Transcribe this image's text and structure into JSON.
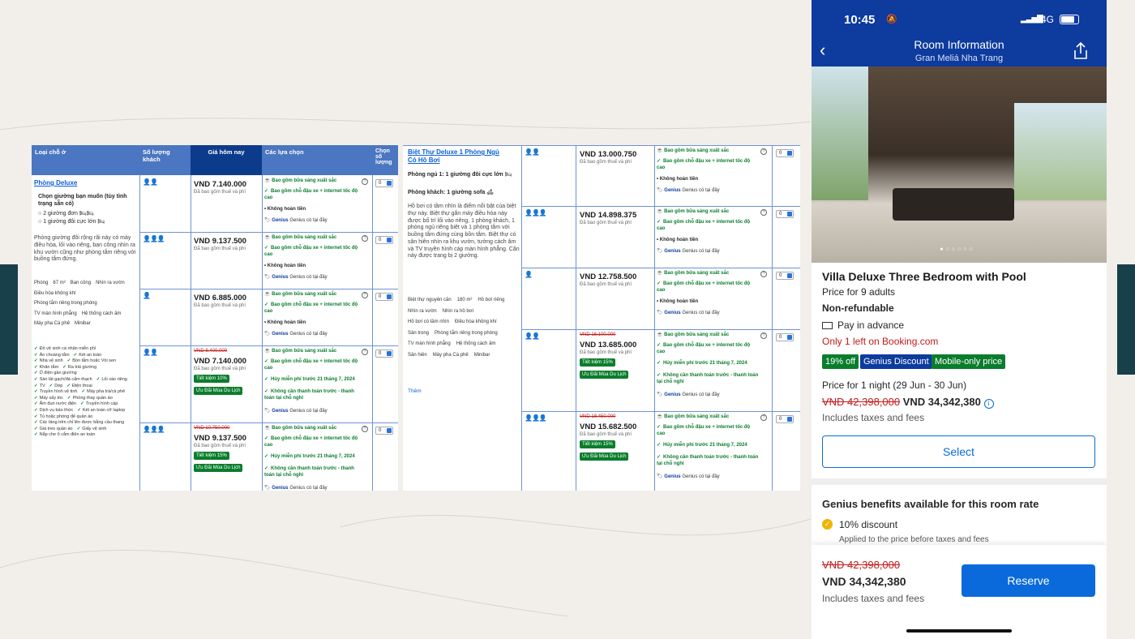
{
  "table": {
    "headers": {
      "type": "Loại chỗ ở",
      "guests": "Số lượng khách",
      "price_today": "Giá hôm nay",
      "choices": "Các lựa chọn",
      "select": "Chọn số lượng"
    },
    "room1": {
      "name": "Phòng Deluxe",
      "bed_prompt": "Chọn giường bạn muốn (tùy tình trạng sẵn có)",
      "bed_option1": "2 giường đơn",
      "bed_option2": "1 giường đôi cực lớn",
      "description": "Phòng giường đôi rộng rãi này có máy điều hòa, lối vào riêng, ban công nhìn ra khu vườn cũng như phòng tắm riêng với buồng tắm đứng.",
      "facilities": [
        "Phòng",
        "67 m²",
        "Ban công",
        "Nhìn ra vườn",
        "Điều hòa không khí",
        "Phòng tắm riêng trong phòng",
        "TV màn hình phẳng",
        "Hệ thống cách âm",
        "Máy pha Cà phê",
        "Minibar"
      ],
      "amenities": [
        "Đồ vệ sinh cá nhân miễn phí",
        "Áo choàng tắm",
        "Két an toàn",
        "Nhà vệ sinh",
        "Bồn tắm hoặc Vòi sen",
        "Khăn tắm",
        "Ra trải giường",
        "Ổ điện gần giường",
        "Sàn lát gạch/đá cẩm thạch",
        "Lối vào riêng",
        "TV",
        "Dép",
        "Điện thoại",
        "Truyền hình vệ tinh",
        "Máy pha trà/cà phê",
        "Máy sấy tóc",
        "Phòng thay quần áo",
        "Ấm đun nước điện",
        "Truyền hình cáp",
        "Dịch vụ báo thức",
        "Két an toàn cỡ laptop",
        "Tủ hoặc phòng để quần áo",
        "Các tầng trên chỉ lên được bằng cầu thang",
        "Giá treo quần áo",
        "Giấy vệ sinh",
        "Nắp che ổ cắm điện an toàn"
      ]
    },
    "room2": {
      "name": "Biệt Thự Deluxe 1 Phòng Ngủ Có Hồ Bơi",
      "bedroom": "Phòng ngủ 1: 1 giường đôi cực lớn",
      "living": "Phòng khách: 1 giường sofa",
      "description": "Hồ bơi có tầm nhìn là điểm nổi bật của biệt thự này. Biệt thự gắn máy điều hòa này được bố trí lối vào riêng, 1 phòng khách, 1 phòng ngủ riêng biệt và 1 phòng tắm với buồng tắm đứng cùng bồn tắm. Biệt thự có sân hiên nhìn ra khu vườn, tường cách âm và TV truyền hình cáp màn hình phẳng. Căn này được trang bị 2 giường.",
      "facilities": [
        "Biệt thự nguyên căn",
        "180 m²",
        "Hồ bơi riêng",
        "Nhìn ra vườn",
        "Nhìn ra hồ bơi",
        "Hồ bơi có tầm nhìn",
        "Điều hòa không khí",
        "Sân trong",
        "Phòng tắm riêng trong phòng",
        "TV màn hình phẳng",
        "Hệ thống cách âm",
        "Sân hiên",
        "Máy pha Cà phê",
        "Minibar"
      ],
      "more": "Thêm"
    },
    "taxes_note": "Đã bao gồm thuế và phí",
    "opt_breakfast": "Bao gồm bữa sáng xuất sắc",
    "opt_parking": "Bao gồm chỗ đậu xe + internet tốc độ cao",
    "opt_nonrefund": "Không hoàn tiền",
    "opt_genius": "Genius có tại đây",
    "opt_freecancel": "Hủy miễn phí trước 21 tháng 7, 2024",
    "opt_nopay": "Không cần thanh toán trước - thanh toán tại chỗ nghỉ",
    "badge_save": "Tiết kiệm 15%",
    "badge_save10": "Tiết kiệm 10%",
    "badge_deal": "Ưu Đãi Mùa Du Lịch",
    "qty": "0",
    "rows1": [
      {
        "old": "",
        "price": "VND 7.140.000"
      },
      {
        "old": "",
        "price": "VND 9.137.500"
      },
      {
        "old": "",
        "price": "VND 6.885.000"
      },
      {
        "old": "VND 8.400.000",
        "price": "VND 7.140.000"
      },
      {
        "old": "VND 10.750.000",
        "price": "VND 9.137.500"
      }
    ],
    "rows2": [
      {
        "old": "",
        "price": "VND 13.000.750"
      },
      {
        "old": "",
        "price": "VND 14.898.375"
      },
      {
        "old": "",
        "price": "VND 12.758.500"
      },
      {
        "old": "VND 16.100.000",
        "price": "VND 13.685.000"
      },
      {
        "old": "VND 18.450.000",
        "price": "VND 15.682.500"
      }
    ]
  },
  "phone": {
    "time": "10:45",
    "network": "4G",
    "header_title": "Room Information",
    "header_subtitle": "Gran Meliá Nha Trang",
    "room_title": "Villa Deluxe Three Bedroom with Pool",
    "price_for": "Price for 9 adults",
    "refund": "Non-refundable",
    "pay": "Pay in advance",
    "scarcity": "Only 1 left on Booking.com",
    "tags": [
      "19% off",
      "Genius Discount",
      "Mobile-only price"
    ],
    "price_night": "Price for 1 night (29 Jun - 30 Jun)",
    "old_price": "VND 42,398,000",
    "new_price": "VND 34,342,380",
    "includes": "Includes taxes and fees",
    "select": "Select",
    "genius_title": "Genius benefits available for this room rate",
    "discount": "10% discount",
    "discount_note": "Applied to the price before taxes and fees",
    "reserve": "Reserve",
    "colors": {
      "brand": "#0d3b9e",
      "green": "#0a7d2c",
      "action": "#0a6adb",
      "alert": "#c21a1a"
    }
  }
}
